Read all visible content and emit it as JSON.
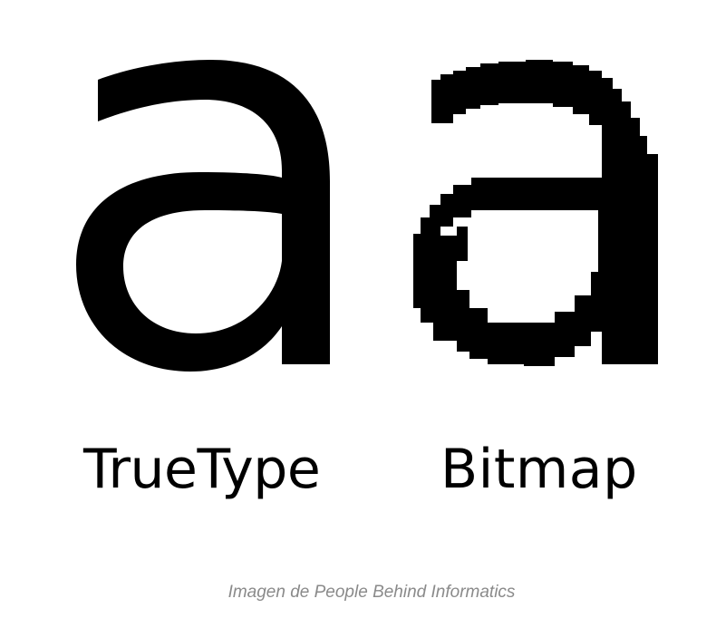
{
  "figure": {
    "left_label": "TrueType",
    "right_label": "Bitmap",
    "left_glyph_name": "vector-letter-a",
    "right_glyph_name": "pixelated-letter-a",
    "glyph_color": "#000000"
  },
  "caption": {
    "text": "Imagen de People Behind Informatics",
    "color": "#8a8a8a"
  }
}
